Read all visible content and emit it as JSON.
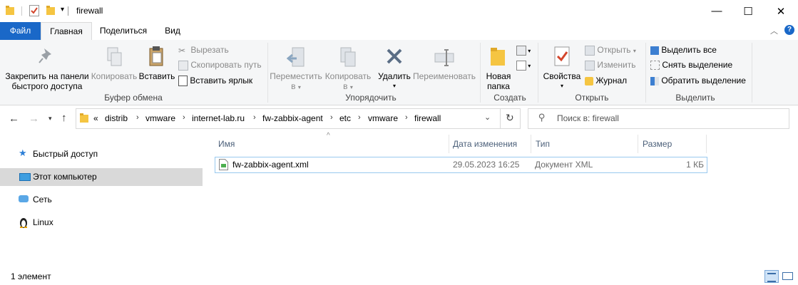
{
  "window": {
    "title": "firewall"
  },
  "tabs": {
    "file": "Файл",
    "home": "Главная",
    "share": "Поделиться",
    "view": "Вид"
  },
  "ribbon": {
    "clipboard": {
      "label": "Буфер обмена",
      "pin": [
        "Закрепить на панели",
        "быстрого доступа"
      ],
      "copy": "Копировать",
      "paste": "Вставить",
      "cut": "Вырезать",
      "copy_path": "Скопировать путь",
      "paste_shortcut": "Вставить ярлык"
    },
    "organize": {
      "label": "Упорядочить",
      "move": [
        "Переместить",
        "в"
      ],
      "copy_to": [
        "Копировать",
        "в"
      ],
      "delete": "Удалить",
      "rename": "Переименовать"
    },
    "create": {
      "label": "Создать",
      "new_folder": [
        "Новая",
        "папка"
      ]
    },
    "open": {
      "label": "Открыть",
      "properties": "Свойства",
      "open": "Открыть",
      "edit": "Изменить",
      "history": "Журнал"
    },
    "select": {
      "label": "Выделить",
      "select_all": "Выделить все",
      "select_none": "Снять выделение",
      "invert": "Обратить выделение"
    }
  },
  "address": {
    "overflow": "«",
    "crumbs": [
      "distrib",
      "vmware",
      "internet-lab.ru",
      "fw-zabbix-agent",
      "etc",
      "vmware",
      "firewall"
    ]
  },
  "search": {
    "placeholder": "Поиск в: firewall"
  },
  "nav": [
    {
      "label": "Быстрый доступ",
      "icon": "star-icon"
    },
    {
      "label": "Этот компьютер",
      "icon": "computer-icon"
    },
    {
      "label": "Сеть",
      "icon": "network-icon"
    },
    {
      "label": "Linux",
      "icon": "linux-icon"
    }
  ],
  "columns": {
    "name": "Имя",
    "date": "Дата изменения",
    "type": "Тип",
    "size": "Размер"
  },
  "files": [
    {
      "name": "fw-zabbix-agent.xml",
      "date": "29.05.2023 16:25",
      "type": "Документ XML",
      "size": "1 КБ"
    }
  ],
  "status": {
    "count": "1 элемент"
  },
  "colors": {
    "accent": "#1a68c8",
    "selected_nav": "#d9d9d9",
    "row_border": "#99c9ef",
    "folder": "#f5c542"
  }
}
